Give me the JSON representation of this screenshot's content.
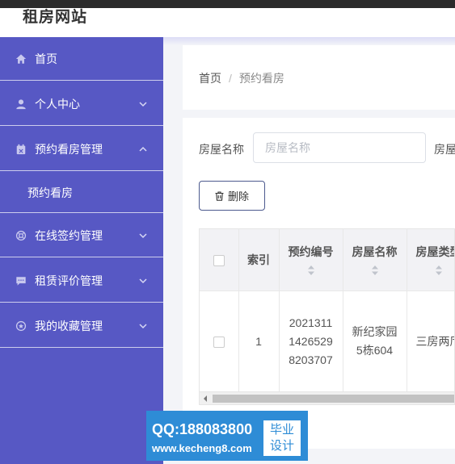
{
  "header": {
    "site_title": "租房网站"
  },
  "sidebar": {
    "items": [
      {
        "label": "首页",
        "icon": "home-icon"
      },
      {
        "label": "个人中心",
        "icon": "user-icon"
      },
      {
        "label": "预约看房管理",
        "icon": "calendar-icon",
        "expanded": true
      },
      {
        "label": "预约看房",
        "sub": true
      },
      {
        "label": "在线签约管理",
        "icon": "contract-icon"
      },
      {
        "label": "租赁评价管理",
        "icon": "comment-icon"
      },
      {
        "label": "我的收藏管理",
        "icon": "star-icon"
      }
    ]
  },
  "breadcrumb": {
    "home": "首页",
    "separator": "/",
    "current": "预约看房"
  },
  "search": {
    "label": "房屋名称",
    "placeholder": "房屋名称",
    "label2": "房屋"
  },
  "toolbar": {
    "delete_label": "删除"
  },
  "table": {
    "columns": [
      "",
      "索引",
      "预约编号",
      "房屋名称",
      "房屋类型"
    ],
    "rows": [
      {
        "index": "1",
        "booking_no_lines": [
          "2021311",
          "1426529",
          "8203707"
        ],
        "house_name_lines": [
          "新纪家园",
          "5栋604"
        ],
        "house_type": "三房两厅"
      }
    ]
  },
  "watermark": {
    "qq": "QQ:188083800",
    "site": "www.kecheng8.com",
    "tag_line1": "毕业",
    "tag_line2": "设计"
  },
  "colors": {
    "sidebar": "#5758c4",
    "accent_border": "#4c5a8e",
    "watermark": "#2e8cd6"
  }
}
